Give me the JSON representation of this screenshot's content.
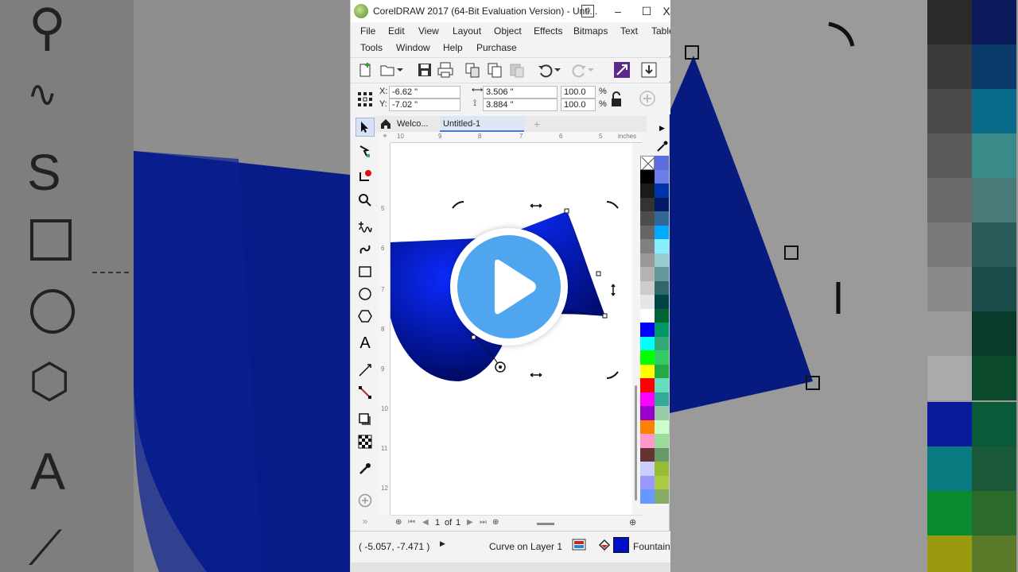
{
  "window": {
    "title": "CorelDRAW 2017 (64-Bit Evaluation Version) - Unti...",
    "minimize_glyph": "–",
    "maximize_glyph": "☐",
    "close_glyph": "X"
  },
  "menu": {
    "row1": [
      "File",
      "Edit",
      "View",
      "Layout",
      "Object",
      "Effects",
      "Bitmaps",
      "Text",
      "Table"
    ],
    "row2": [
      "Tools",
      "Window",
      "Help",
      "Purchase"
    ]
  },
  "property_bar": {
    "x_label": "X:",
    "x_value": "-6.62 \"",
    "y_label": "Y:",
    "y_value": "-7.02 \"",
    "width_value": "3.506 \"",
    "height_value": "3.884 \"",
    "scale_x": "100.0",
    "scale_y": "100.0",
    "percent_x": "%",
    "percent_y": "%"
  },
  "tabs": {
    "welcome": "Welco...",
    "document": "Untitled-1",
    "add": "+"
  },
  "rulers": {
    "unit": "inches",
    "top_ticks": [
      "10",
      "9",
      "8",
      "7",
      "6",
      "5"
    ],
    "left_ticks": [
      "5",
      "6",
      "7",
      "8",
      "9",
      "10",
      "11",
      "12"
    ]
  },
  "page_nav": {
    "current": "1",
    "of_label": "of",
    "total": "1"
  },
  "status": {
    "coords": "( -5.057, -7.471 )",
    "object_info": "Curve on Layer 1",
    "fill_label": "Fountain"
  },
  "colors": {
    "fill_dark": "#000a66",
    "fill_bright": "#0a2bff",
    "accent_play": "#4fa6ee",
    "selected_tab": "#dde6f5"
  },
  "palette_left": [
    "#ffffff",
    "#000000",
    "#1a1a1a",
    "#333333",
    "#4d4d4d",
    "#666666",
    "#808080",
    "#999999",
    "#b3b3b3",
    "#cccccc",
    "#e6e6e6",
    "#ffffff",
    "#0000ff",
    "#00ffff",
    "#00ff00",
    "#ffff00",
    "#ff0000",
    "#ff00ff",
    "#9900cc",
    "#ff8000",
    "#ff99cc",
    "#663333",
    "#ccccff",
    "#9999ff",
    "#6699ff"
  ],
  "palette_right": [
    "#5a6ee0",
    "#6b7ee8",
    "#0033aa",
    "#001a66",
    "#336699",
    "#00aaff",
    "#88eeff",
    "#99cccc",
    "#669999",
    "#336666",
    "#004444",
    "#006633",
    "#009966",
    "#33aa77",
    "#33cc66",
    "#22aa44",
    "#66ddbb",
    "#33aa99",
    "#99ccaa",
    "#ccffcc",
    "#99dd99",
    "#669966",
    "#99bb33",
    "#aacc44",
    "#88aa66"
  ],
  "icons": {
    "play": "play-icon",
    "home": "home-icon",
    "lock": "unlock-icon"
  }
}
